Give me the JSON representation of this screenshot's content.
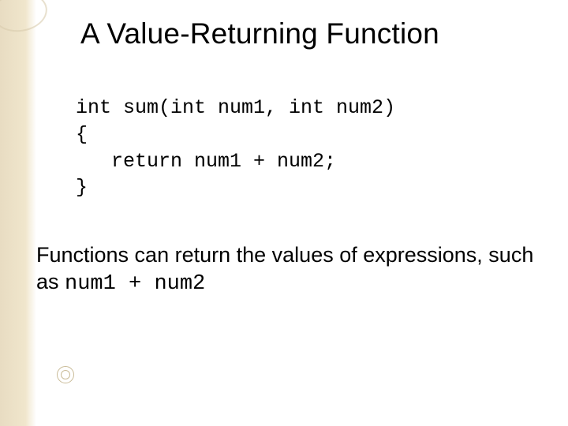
{
  "title": "A Value-Returning Function",
  "code": {
    "line1": "int sum(int num1, int num2)",
    "line2": "{",
    "line3": "   return num1 + num2;",
    "line4": "}"
  },
  "description": {
    "text_part1": "Functions can return the values of expressions, such as ",
    "mono_part": "num1 + num2"
  }
}
